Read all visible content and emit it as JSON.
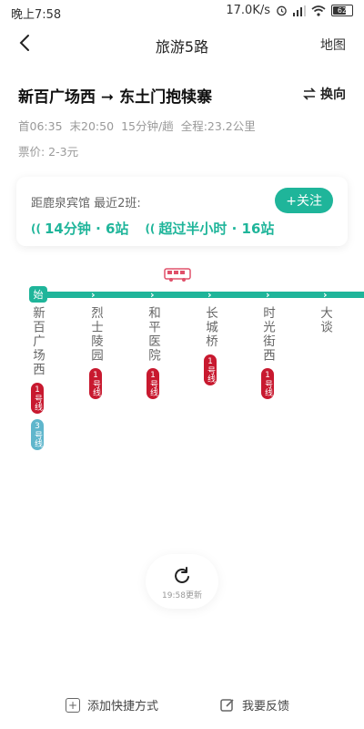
{
  "status_bar": {
    "time": "晚上7:58",
    "speed": "17.0K/s",
    "battery": "62"
  },
  "nav": {
    "title": "旅游5路",
    "map_label": "地图"
  },
  "route": {
    "title": "新百广场西 ➞ 东土门抱犊寨",
    "switch_label": "换向",
    "first_bus": "首06:35",
    "last_bus": "末20:50",
    "interval": "15分钟/趟",
    "distance": "全程:23.2公里",
    "fare": "票价: 2-3元"
  },
  "arrival": {
    "station_text": "距鹿泉宾馆 最近2班:",
    "follow_label": "+关注",
    "times": [
      "14分钟 · 6站",
      "超过半小时 · 16站"
    ]
  },
  "line": {
    "start_label": "始",
    "stations": [
      {
        "name": "新百广场西",
        "metro": [
          {
            "label": "1号线",
            "color": "red"
          },
          {
            "label": "3号线",
            "color": "blue"
          }
        ]
      },
      {
        "name": "烈士陵园",
        "metro": [
          {
            "label": "1号线",
            "color": "red"
          }
        ]
      },
      {
        "name": "和平医院",
        "metro": [
          {
            "label": "1号线",
            "color": "red"
          }
        ]
      },
      {
        "name": "长城桥",
        "metro": [
          {
            "label": "1号线",
            "color": "red"
          }
        ]
      },
      {
        "name": "时光街西",
        "metro": [
          {
            "label": "1号线",
            "color": "red"
          }
        ]
      },
      {
        "name": "大谈",
        "metro": []
      }
    ]
  },
  "refresh": {
    "text": "19:58更新"
  },
  "bottom": {
    "shortcut_label": "添加快捷方式",
    "feedback_label": "我要反馈"
  },
  "colors": {
    "accent": "#1fb59a",
    "metro_red": "#c8192f",
    "metro_blue": "#5fb6cc"
  }
}
